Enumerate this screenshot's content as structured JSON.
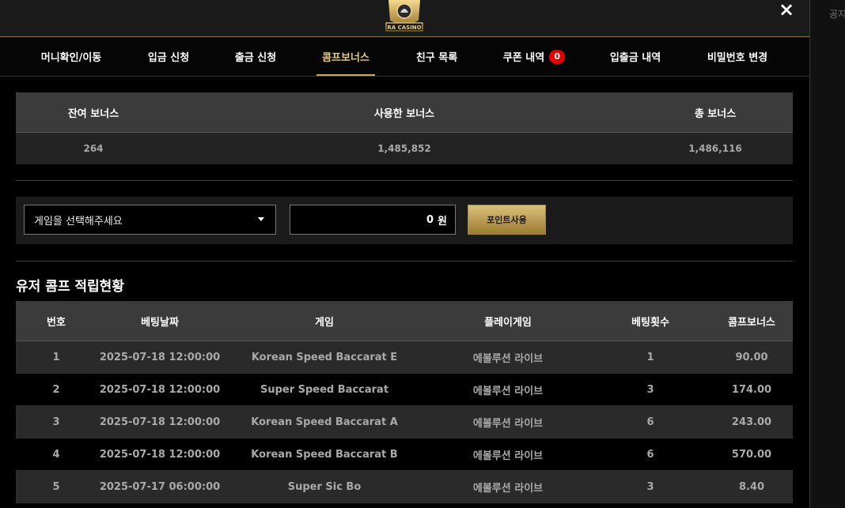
{
  "outside_text": "공지",
  "header": {
    "logo_text": "RA CASINO",
    "close_label": "×"
  },
  "tabs": [
    {
      "label": "머니확인/이동"
    },
    {
      "label": "입금 신청"
    },
    {
      "label": "출금 신청"
    },
    {
      "label": "콤프보너스"
    },
    {
      "label": "친구 목록"
    },
    {
      "label": "쿠폰 내역",
      "badge": "0"
    },
    {
      "label": "입출금 내역"
    },
    {
      "label": "비밀번호 변경"
    }
  ],
  "summary": {
    "headers": [
      "잔여 보너스",
      "사용한 보너스",
      "총 보너스"
    ],
    "values": [
      "264",
      "1,485,852",
      "1,486,116"
    ]
  },
  "form": {
    "select_value": "게임을 선택해주세요",
    "amount_value": "0",
    "amount_unit": "원",
    "use_button": "포인트사용"
  },
  "section_title": "유저 콤프 적립현황",
  "table": {
    "headers": [
      "번호",
      "베팅날짜",
      "게임",
      "플레이게임",
      "베팅횟수",
      "콤프보너스"
    ],
    "rows": [
      [
        "1",
        "2025-07-18 12:00:00",
        "Korean Speed Baccarat E",
        "에볼루션 라이브",
        "1",
        "90.00"
      ],
      [
        "2",
        "2025-07-18 12:00:00",
        "Super Speed Baccarat",
        "에볼루션 라이브",
        "3",
        "174.00"
      ],
      [
        "3",
        "2025-07-18 12:00:00",
        "Korean Speed Baccarat A",
        "에볼루션 라이브",
        "6",
        "243.00"
      ],
      [
        "4",
        "2025-07-18 12:00:00",
        "Korean Speed Baccarat B",
        "에볼루션 라이브",
        "6",
        "570.00"
      ],
      [
        "5",
        "2025-07-17 06:00:00",
        "Super Sic Bo",
        "에볼루션 라이브",
        "3",
        "8.40"
      ]
    ]
  },
  "colors": {
    "accent_gold": "#c9aa5b",
    "badge_red": "#e00000"
  }
}
